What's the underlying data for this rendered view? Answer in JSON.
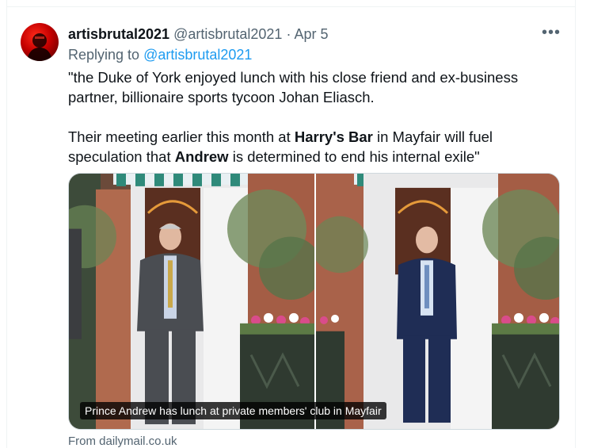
{
  "tweet": {
    "display_name": "artisbrutal2021",
    "handle": "@artisbrutal2021",
    "separator": "·",
    "date": "Apr 5",
    "more_icon": "more-horizontal-icon",
    "reply_prefix": "Replying to",
    "reply_handle": "@artisbrutal2021",
    "text": {
      "p1": "\"the Duke of York enjoyed lunch with his close friend and ex-business partner, billionaire sports tycoon Johan Eliasch.",
      "p2_a": "Their meeting earlier this month at ",
      "p2_bold1": "Harry's Bar",
      "p2_b": " in Mayfair will fuel speculation that ",
      "p2_bold2": "Andrew",
      "p2_c": " is determined to end his internal exile\""
    },
    "media": {
      "caption": "Prince Andrew has lunch at private members' club in Mayfair",
      "photo_count": 2
    },
    "source": "From dailymail.co.uk"
  },
  "colors": {
    "text": "#0f1419",
    "muted": "#536471",
    "link": "#1d9bf0",
    "border": "#eff3f4"
  }
}
